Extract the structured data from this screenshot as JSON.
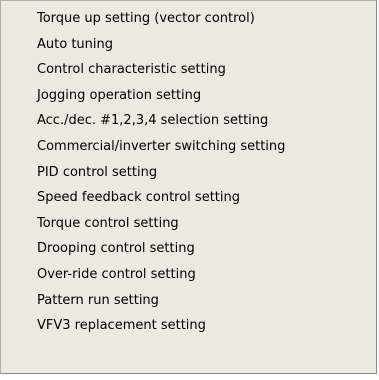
{
  "menu": {
    "items": [
      {
        "label": "Torque up setting (vector control)"
      },
      {
        "label": "Auto tuning"
      },
      {
        "label": "Control characteristic setting"
      },
      {
        "label": "Jogging operation setting"
      },
      {
        "label": "Acc./dec. #1,2,3,4 selection setting"
      },
      {
        "label": "Commercial/inverter switching setting"
      },
      {
        "label": "PID control setting"
      },
      {
        "label": "Speed feedback control setting"
      },
      {
        "label": "Torque control setting"
      },
      {
        "label": "Drooping control setting"
      },
      {
        "label": "Over-ride control setting"
      },
      {
        "label": "Pattern run setting"
      },
      {
        "label": "VFV3 replacement setting"
      }
    ]
  },
  "colors": {
    "menu_background": "#ece9e0",
    "text": "#000000"
  }
}
